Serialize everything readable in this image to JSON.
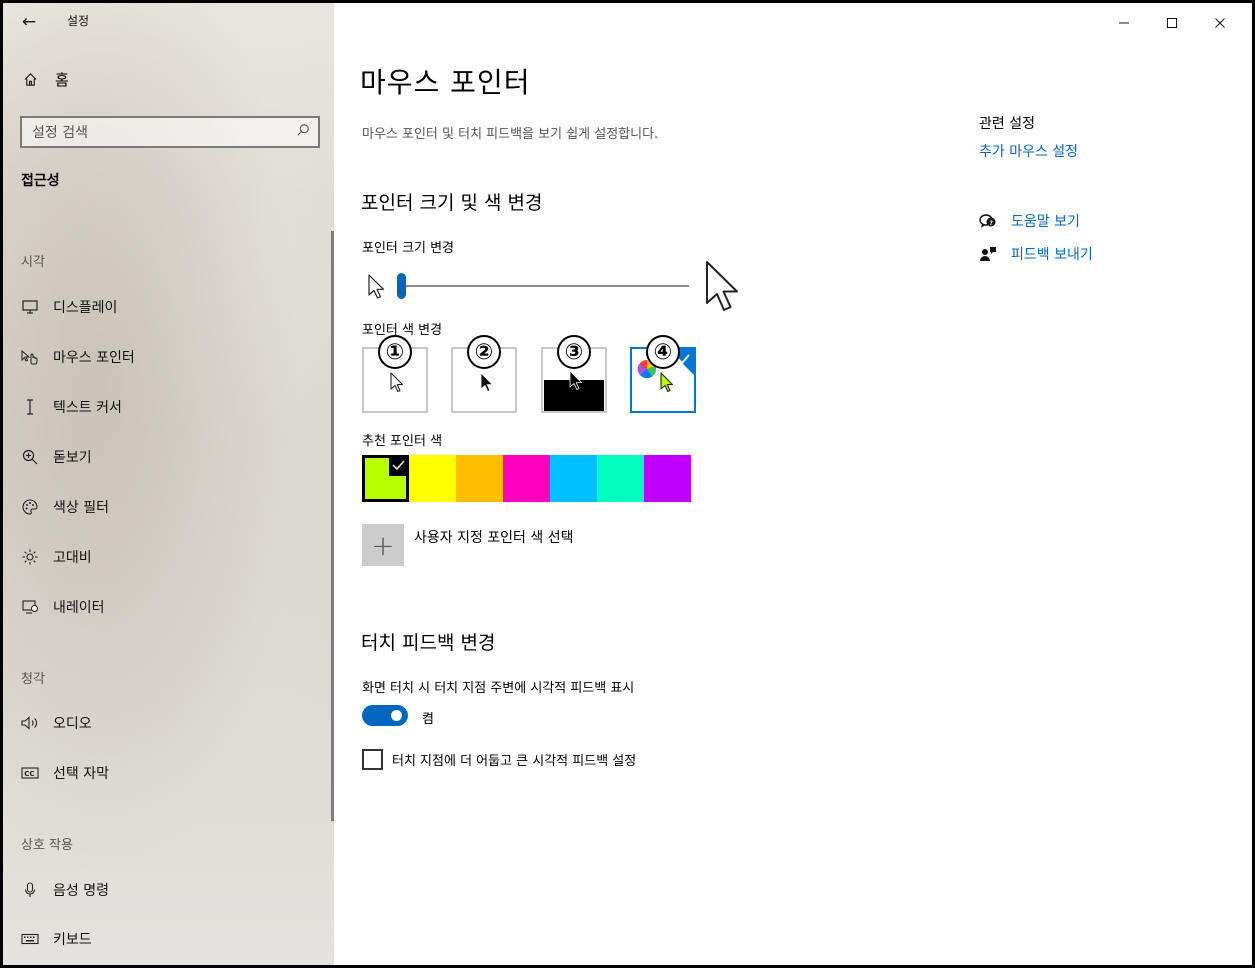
{
  "window": {
    "app_title": "설정",
    "controls": {
      "minimize": "–",
      "maximize": "☐",
      "close": "✕"
    }
  },
  "sidebar": {
    "home_label": "홈",
    "search_placeholder": "설정 검색",
    "category": "접근성",
    "groups": [
      {
        "label": "시각",
        "items": [
          {
            "label": "디스플레이",
            "icon": "display-icon"
          },
          {
            "label": "마우스 포인터",
            "icon": "pointer-hand-icon"
          },
          {
            "label": "텍스트 커서",
            "icon": "text-cursor-icon"
          },
          {
            "label": "돋보기",
            "icon": "magnifier-icon"
          },
          {
            "label": "색상 필터",
            "icon": "palette-icon"
          },
          {
            "label": "고대비",
            "icon": "brightness-icon"
          },
          {
            "label": "내레이터",
            "icon": "narrator-icon"
          }
        ]
      },
      {
        "label": "청각",
        "items": [
          {
            "label": "오디오",
            "icon": "speaker-icon"
          },
          {
            "label": "선택 자막",
            "icon": "caption-icon"
          }
        ]
      },
      {
        "label": "상호 작용",
        "items": [
          {
            "label": "음성 명령",
            "icon": "microphone-icon"
          },
          {
            "label": "키보드",
            "icon": "keyboard-icon"
          }
        ]
      }
    ]
  },
  "main": {
    "title": "마우스 포인터",
    "subtitle": "마우스 포인터 및 터치 피드백을 보기 쉽게 설정합니다.",
    "pointer_section": {
      "title": "포인터 크기 및 색 변경",
      "size_label": "포인터 크기 변경",
      "size_value": 1,
      "size_min": 1,
      "size_max": 15,
      "color_label": "포인터 색 변경",
      "color_options": [
        {
          "badge": "①",
          "name": "white",
          "selected": false
        },
        {
          "badge": "②",
          "name": "black",
          "selected": false
        },
        {
          "badge": "③",
          "name": "inverted",
          "selected": false
        },
        {
          "badge": "④",
          "name": "custom",
          "selected": true
        }
      ],
      "suggested_label": "추천 포인터 색",
      "suggested_colors": [
        "#b7ff00",
        "#ffff00",
        "#ffbf00",
        "#ff00bf",
        "#00bfff",
        "#00ffbf",
        "#bf00ff"
      ],
      "selected_suggested_index": 0,
      "custom_button_icon": "+",
      "custom_label": "사용자 지정 포인터 색 선택"
    },
    "touch_section": {
      "title": "터치 피드백 변경",
      "toggle_label": "화면 터치 시 터치 지점 주변에 시각적 피드백 표시",
      "toggle_state": "켬",
      "toggle_on": true,
      "checkbox_label": "터치 지점에 더 어둡고 큰 시각적 피드백 설정",
      "checkbox_checked": false
    }
  },
  "related": {
    "title": "관련 설정",
    "link": "추가 마우스 설정",
    "help_label": "도움말 보기",
    "feedback_label": "피드백 보내기"
  },
  "colors": {
    "accent": "#0067c0",
    "selected_border": "#0078d7"
  }
}
